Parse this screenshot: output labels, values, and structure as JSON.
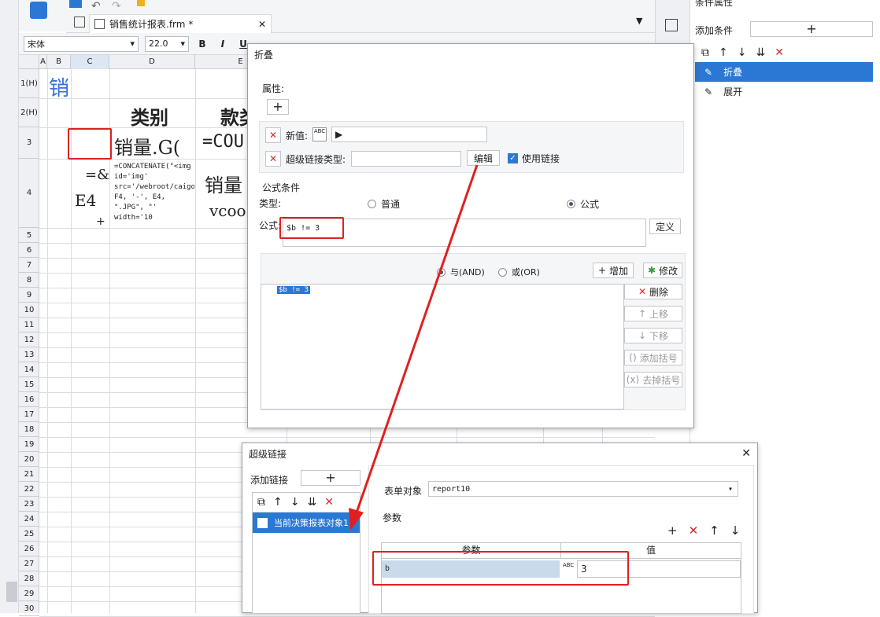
{
  "editor": {
    "tab_title": "销售统计报表.frm *",
    "font_name": "宋体",
    "font_size": "22.0",
    "bold": "B",
    "italic": "I",
    "underline": "U",
    "tab_menu_arrow": "▼"
  },
  "sheet": {
    "columns": [
      "A",
      "B",
      "C",
      "D",
      "E"
    ],
    "rows": [
      "1(H)",
      "2(H)",
      "3",
      "4",
      "5",
      "6",
      "7",
      "8",
      "9",
      "10",
      "11",
      "12",
      "13",
      "14",
      "15",
      "16",
      "17",
      "18",
      "19",
      "20",
      "21",
      "22",
      "23",
      "24",
      "25",
      "26",
      "27",
      "28",
      "29",
      "30"
    ],
    "cells": {
      "b1": "销",
      "d2": "类别",
      "e2": "款类",
      "d3": "销量.G(",
      "e3": "=COU",
      "c4_line1": "=&",
      "c4_line2": "E4",
      "c4_line3": "+",
      "d4": "=CONCATENATE(\"<img id='img' src='/webroot/caigou/prod/\", F4, '-', E4, \".JPG\", \"' width='10",
      "e4_line1": "销量",
      "e4_line2": "vcoo"
    }
  },
  "cond_panel": {
    "title": "条件属性",
    "add_condition_label": "添加条件",
    "add_symbol": "+",
    "items": [
      {
        "label": "折叠",
        "selected": true
      },
      {
        "label": "展开",
        "selected": false
      }
    ]
  },
  "fold_dialog": {
    "title": "折叠",
    "props_label": "属性:",
    "add_symbol": "+",
    "new_value_label": "新值:",
    "new_value": "▶",
    "abc_label": "ABC",
    "hyperlink_type_label": "超级链接类型:",
    "hyperlink_type_value": "",
    "edit_button": "编辑",
    "use_link_label": "使用链接",
    "use_link_checked": true,
    "formula_cond_label": "公式条件",
    "type_label": "类型:",
    "type_normal": "普通",
    "type_formula": "公式",
    "formula_label": "公式:",
    "formula_value": "$b != 3",
    "define_button": "定义",
    "and_label": "与(AND)",
    "or_label": "或(OR)",
    "add_button": "增加",
    "modify_button": "修改",
    "delete_button": "删除",
    "up_button": "上移",
    "down_button": "下移",
    "add_paren_button": "添加括号",
    "remove_paren_button": "去掉括号",
    "condition_list": [
      "$b != 3"
    ]
  },
  "link_dialog": {
    "title": "超级链接",
    "add_link_label": "添加链接",
    "add_symbol": "+",
    "list_item": "当前决策报表对象1",
    "form_object_label": "表单对象",
    "form_object_value": "report10",
    "params_label": "参数",
    "table_headers": [
      "参数",
      "值"
    ],
    "rows": [
      {
        "param": "b",
        "value": "3"
      }
    ]
  },
  "colors": {
    "accent": "#2b78d4",
    "annotation": "#e02020",
    "delete": "#d8262c"
  }
}
